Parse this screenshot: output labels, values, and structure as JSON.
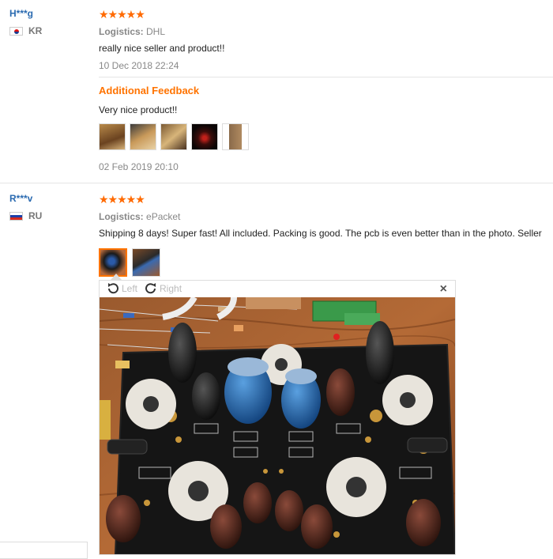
{
  "reviews": [
    {
      "user": "H***g",
      "country": "KR",
      "stars": "★★★★★",
      "logistics_label": "Logistics:",
      "logistics_value": "DHL",
      "text": "really nice seller and product!!",
      "date": "10 Dec 2018 22:24",
      "additional": {
        "heading": "Additional Feedback",
        "text": "Very nice product!!",
        "date": "02 Feb 2019 20:10",
        "thumbnail_count": 5
      }
    },
    {
      "user": "R***v",
      "country": "RU",
      "stars": "★★★★★",
      "logistics_label": "Logistics:",
      "logistics_value": "ePacket",
      "text": "Shipping 8 days! Super fast! All included. Packing is good. The pcb is even better than in the photo. Seller",
      "thumbnail_count": 2,
      "selected_thumbnail": 1
    }
  ],
  "viewer": {
    "rotate_left": "Left",
    "rotate_right": "Right",
    "close": "×",
    "photo_icon": "tube-amplifier-pcb-photo"
  },
  "colors": {
    "username": "#2a6ab0",
    "stars": "#ff6a00",
    "additional_heading": "#ff7300"
  }
}
